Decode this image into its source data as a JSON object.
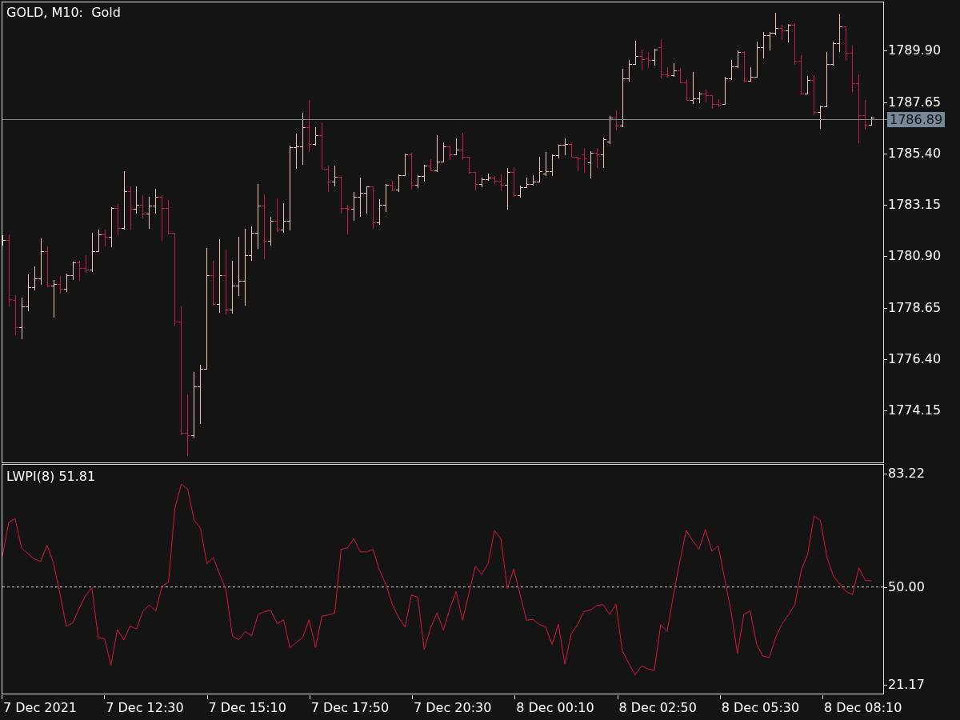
{
  "price_chart": {
    "title": "GOLD, M10:  Gold",
    "current_price": "1786.89",
    "axis_labels": [
      "1789.90",
      "1787.65",
      "1785.40",
      "1783.15",
      "1780.90",
      "1778.65",
      "1776.40",
      "1774.15"
    ]
  },
  "indicator": {
    "chart_data": {
      "type": "line",
      "title": "LWPI(8) 51.81",
      "ylim": [
        18.44,
        86.13
      ],
      "yticks": [
        {
          "value": 83.22,
          "label": "83.22"
        },
        {
          "value": 21.17,
          "label": "21.17"
        }
      ],
      "ref_lines": [
        {
          "axis": "y",
          "value": 50,
          "label": "50.00"
        }
      ],
      "series": [
        {
          "color": "#dc143c",
          "values": [
            58.8,
            69.0,
            70.1,
            61.5,
            59.8,
            58.2,
            57.5,
            62.3,
            57.1,
            48.2,
            38.5,
            39.4,
            43.6,
            47.4,
            49.8,
            35.0,
            34.9,
            27.0,
            37.5,
            34.5,
            38.5,
            37.7,
            42.9,
            44.7,
            42.9,
            50.3,
            51.4,
            73.1,
            80.2,
            78.7,
            69.7,
            67.2,
            56.9,
            58.6,
            53.7,
            49.1,
            35.6,
            34.5,
            36.9,
            35.6,
            41.9,
            42.8,
            43.1,
            39.2,
            40.4,
            32.1,
            33.7,
            35.2,
            40.4,
            32.2,
            41.4,
            41.8,
            42.3,
            61.1,
            61.5,
            64.2,
            60.3,
            60.3,
            61.0,
            55.0,
            50.8,
            44.9,
            41.1,
            38.2,
            47.6,
            47.0,
            31.6,
            37.9,
            42.4,
            37.3,
            43.6,
            48.7,
            40.2,
            48.2,
            56.1,
            53.7,
            56.9,
            66.6,
            64.2,
            49.5,
            55.2,
            47.8,
            40.2,
            40.5,
            39.0,
            38.3,
            33.1,
            39.0,
            27.3,
            36.2,
            39.0,
            42.8,
            43.2,
            44.6,
            44.8,
            41.9,
            45.0,
            31.2,
            27.6,
            24.2,
            26.8,
            25.9,
            25.5,
            39.0,
            36.9,
            47.8,
            57.5,
            66.6,
            63.6,
            61.1,
            66.9,
            60.5,
            62.1,
            52.4,
            42.8,
            30.5,
            41.9,
            43.0,
            33.3,
            29.7,
            29.3,
            35.3,
            39.2,
            41.9,
            44.9,
            55.0,
            59.6,
            70.9,
            69.5,
            58.8,
            53.3,
            50.8,
            48.7,
            47.8,
            55.7,
            51.9,
            51.8
          ]
        }
      ]
    }
  },
  "time_axis": {
    "labels": [
      "7 Dec 2021",
      "7 Dec 12:30",
      "7 Dec 15:10",
      "7 Dec 17:50",
      "7 Dec 20:30",
      "8 Dec 00:10",
      "8 Dec 02:50",
      "8 Dec 05:30",
      "8 Dec 08:10"
    ]
  }
}
